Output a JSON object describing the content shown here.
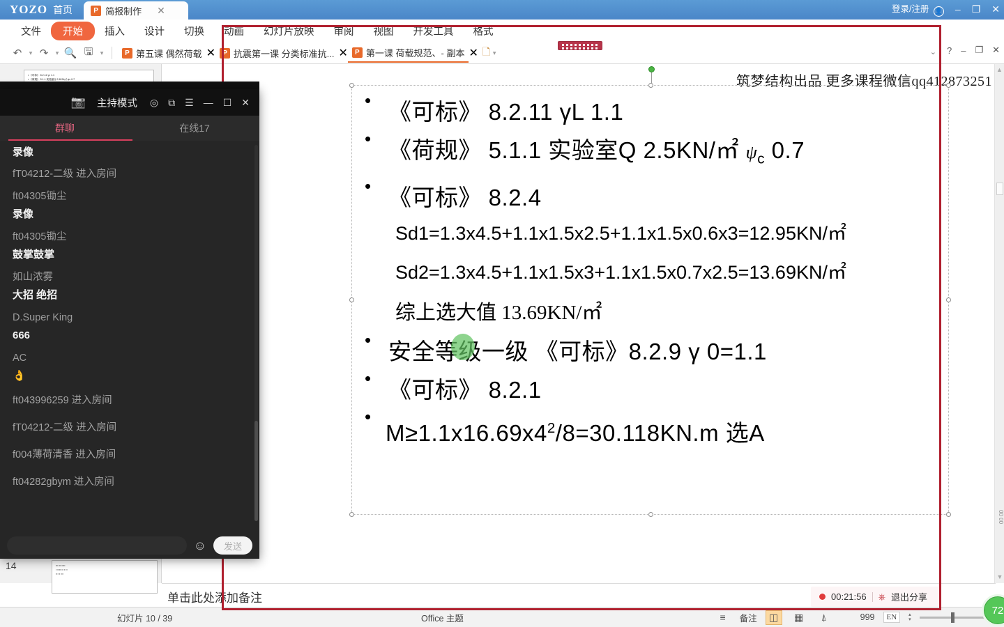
{
  "titlebar": {
    "brand_logo": "YOZO",
    "home_label": "首页",
    "doc_tab_label": "简报制作",
    "doc_tab_icon": "P",
    "close_tab_icon": "✕",
    "login_label": "登录/注册",
    "user_icon": "user-icon",
    "minimize_icon": "–",
    "restore_icon": "❐",
    "close_icon": "✕"
  },
  "ribbon": {
    "menu": [
      {
        "label": "文件",
        "active": false
      },
      {
        "label": "开始",
        "active": true
      },
      {
        "label": "插入",
        "active": false
      },
      {
        "label": "设计",
        "active": false
      },
      {
        "label": "切换",
        "active": false
      },
      {
        "label": "动画",
        "active": false
      },
      {
        "label": "幻灯片放映",
        "active": false
      },
      {
        "label": "审阅",
        "active": false
      },
      {
        "label": "视图",
        "active": false
      },
      {
        "label": "开发工具",
        "active": false
      },
      {
        "label": "格式",
        "active": false
      }
    ],
    "quick_icons": [
      "undo-icon",
      "redo-icon",
      "print-preview-icon",
      "save-icon",
      "more-icon"
    ],
    "file_tabs": [
      {
        "label": "第五课 偶然荷载",
        "selected": false
      },
      {
        "label": "抗震第一课 分类标准抗...",
        "selected": false
      },
      {
        "label": "第一课 荷载规范、- 副本",
        "selected": true
      }
    ],
    "new_doc_icon": "new-document-icon",
    "help_icon": "?",
    "collapse_icon": "⌄",
    "win_minimize": "–",
    "win_restore": "❐",
    "win_close": "✕"
  },
  "thumbnails": {
    "visible_number": "14"
  },
  "slide": {
    "watermark": "筑梦结构出品  更多课程微信qq412873251",
    "lines": [
      {
        "level": 1,
        "bullet": true,
        "parts": [
          {
            "t": "《可标》 8.2.11  γL  1.1"
          }
        ]
      },
      {
        "level": 1,
        "bullet": true,
        "parts": [
          {
            "t": "《荷规》 5.1.1  实验室Q  2.5KN/"
          },
          {
            "t": "㎡",
            "serif": true
          },
          {
            "t": "   "
          },
          {
            "t": "ψ",
            "psi": true
          },
          {
            "t": "c",
            "sub": true
          },
          {
            "t": " 0.7"
          }
        ]
      },
      {
        "level": 1,
        "bullet": true,
        "parts": [
          {
            "t": "《可标》 8.2.4"
          }
        ]
      },
      {
        "level": 2,
        "bullet": false,
        "parts": [
          {
            "t": "Sd1=1.3x4.5+1.1x1.5x2.5+1.1x1.5x0.6x3=12.95KN/"
          },
          {
            "t": "㎡",
            "serif": true
          }
        ]
      },
      {
        "level": 2,
        "bullet": false,
        "parts": [
          {
            "t": "Sd2=1.3x4.5+1.1x1.5x3+1.1x1.5x0.7x2.5=13.69KN/"
          },
          {
            "t": "㎡",
            "serif": true
          }
        ]
      },
      {
        "level": 2,
        "bullet": false,
        "parts": [
          {
            "t": "综上选大值  13.69KN/"
          },
          {
            "t": "㎡",
            "serif": true
          }
        ]
      },
      {
        "level": 1,
        "bullet": true,
        "parts": [
          {
            "t": "安全等级一级  《可标》8.2.9  γ 0=1.1"
          }
        ]
      },
      {
        "level": 1,
        "bullet": true,
        "parts": [
          {
            "t": "《可标》 8.2.1"
          }
        ]
      },
      {
        "level": 1,
        "bullet": true,
        "parts": [
          {
            "t": "M≥1.1x16.69x4"
          },
          {
            "t": "2",
            "sup": true
          },
          {
            "t": "/8=30.118KN.m  选A"
          }
        ]
      }
    ],
    "highlight_marker": "green-laser-highlight"
  },
  "notes": {
    "placeholder": "单击此处添加备注"
  },
  "statusbar": {
    "slide_counter": "幻灯片 10 / 39",
    "theme": "Office 主题",
    "notes_label": "备注",
    "icons": [
      "notes-icon",
      "normal-view-icon",
      "slide-sorter-icon",
      "reading-view-icon"
    ],
    "zoom_value": "999",
    "ime_label": "EN",
    "zoom_out_icon": "−",
    "zoom_in_icon": "+"
  },
  "sharebar": {
    "recording_time": "00:21:56",
    "exit_label": "退出分享",
    "rec_icon": "record-dot-icon",
    "power_icon": "power-icon"
  },
  "timer_badge": {
    "value": "72"
  },
  "chat": {
    "window_title": "主持模式",
    "titlebar_icons": [
      "camera-icon",
      "target-icon",
      "popout-icon",
      "menu-icon",
      "minimize-icon",
      "maximize-icon",
      "close-icon"
    ],
    "tabs": [
      {
        "label": "群聊",
        "selected": true
      },
      {
        "label": "在线17",
        "selected": false
      }
    ],
    "messages": [
      {
        "type": "msg",
        "who": "",
        "text": "录像",
        "clipped": true
      },
      {
        "type": "sys",
        "who": "fT04212-二级 进入房间"
      },
      {
        "type": "msg",
        "who": "ft04305锄尘",
        "text": "录像"
      },
      {
        "type": "msg",
        "who": "ft04305锄尘",
        "text": "鼓掌鼓掌"
      },
      {
        "type": "msg",
        "who": "如山浓雾",
        "text": "大招 绝招"
      },
      {
        "type": "msg",
        "who": "D.Super King",
        "text": "666"
      },
      {
        "type": "msg",
        "who": "AC",
        "text": "👌"
      },
      {
        "type": "sys",
        "who": "ft043996259 进入房间"
      },
      {
        "type": "sys",
        "who": "fT04212-二级 进入房间"
      },
      {
        "type": "sys",
        "who": "f004薄荷清香 进入房间"
      },
      {
        "type": "sys",
        "who": "ft04282gbym 进入房间"
      }
    ],
    "input_placeholder": "",
    "emoji_icon": "smiley-icon",
    "send_label": "发送"
  },
  "colors": {
    "accent_orange": "#f0663f",
    "titlebar_blue": "#4a86c8",
    "chat_tab_pink": "#d9405e",
    "annotation_red": "#b0202f",
    "timer_green": "#55c758",
    "record_red": "#e03b3b"
  }
}
